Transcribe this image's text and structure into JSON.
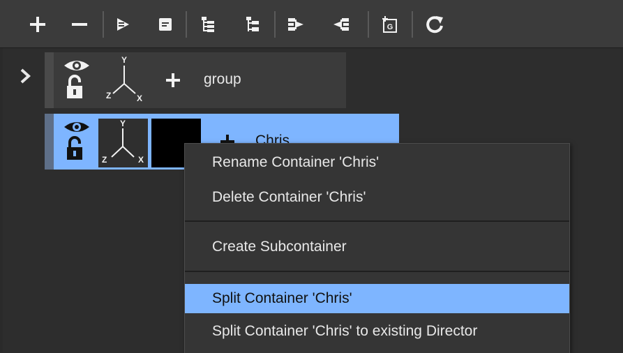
{
  "toolbar": {
    "buttons": [
      {
        "icon": "plus-icon"
      },
      {
        "icon": "minus-icon"
      },
      {
        "icon": "play-icon"
      },
      {
        "icon": "note-icon"
      },
      {
        "icon": "tree-expand-icon"
      },
      {
        "icon": "tree-collapse-icon"
      },
      {
        "icon": "merge-right-icon"
      },
      {
        "icon": "merge-left-icon"
      },
      {
        "icon": "add-geometry-icon",
        "text": "G"
      },
      {
        "icon": "refresh-icon"
      }
    ]
  },
  "tree": {
    "items": [
      {
        "label": "group",
        "state": "normal"
      },
      {
        "label": "Chris",
        "state": "selected"
      }
    ],
    "axis_labels": {
      "y": "Y",
      "z": "Z",
      "x": "X"
    }
  },
  "context_menu": {
    "items": [
      {
        "label": "Rename Container 'Chris'"
      },
      {
        "label": "Delete Container 'Chris'"
      },
      {
        "label": "Create Subcontainer"
      },
      {
        "label": "Split Container 'Chris'",
        "highlighted": true
      },
      {
        "label": "Split Container 'Chris' to existing Director"
      }
    ]
  },
  "colors": {
    "selection": "#7eb5ff",
    "toolbar_bg": "#3b3b3b",
    "menu_bg": "#353535",
    "row_bg": "#3b3b3b"
  }
}
